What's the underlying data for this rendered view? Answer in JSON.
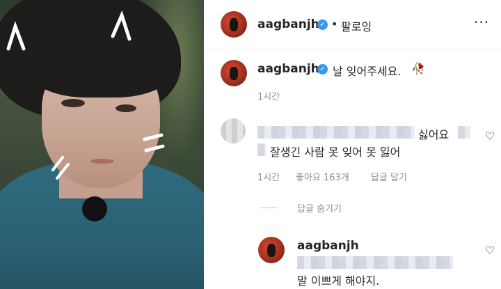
{
  "header": {
    "username": "aagbanjh",
    "separator": "•",
    "follow_label": "팔로잉",
    "more_icon": "···"
  },
  "post": {
    "username": "aagbanjh",
    "caption": "날 잊어주세요.",
    "emoji": "🥀",
    "time": "1시간"
  },
  "comment": {
    "text_suffix": "싫어요",
    "text_line2": "잘생긴 사람 못 잊어 못 잃어",
    "time": "1시간",
    "likes": "좋아요 163개",
    "reply_label": "답글 달기",
    "hide_replies": "답글 숨기기"
  },
  "reply": {
    "username": "aagbanjh",
    "text": "말 이쁘게 해야지."
  },
  "colors": {
    "verified": "#3897f0",
    "muted": "#8e8e8e",
    "text": "#262626"
  }
}
